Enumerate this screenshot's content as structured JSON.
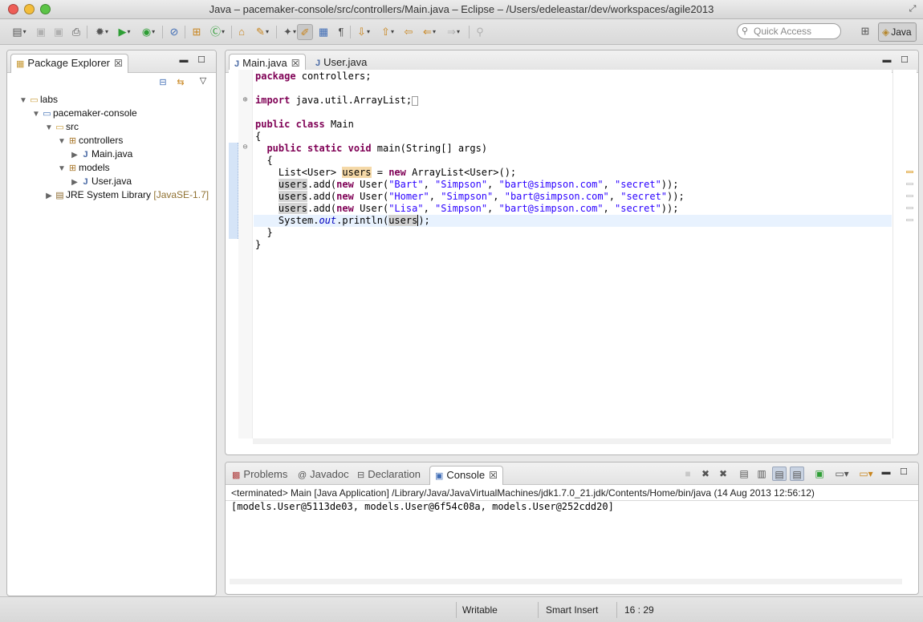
{
  "window": {
    "title": "Java – pacemaker-console/src/controllers/Main.java – Eclipse – /Users/edeleastar/dev/workspaces/agile2013"
  },
  "toolbar": {
    "quick_access_placeholder": "Quick Access",
    "perspective_label": "Java"
  },
  "package_explorer": {
    "title": "Package Explorer",
    "tree": [
      {
        "label": "labs",
        "depth": 0,
        "expanded": true,
        "icon": "folder-icon"
      },
      {
        "label": "pacemaker-console",
        "depth": 1,
        "expanded": true,
        "icon": "project-icon"
      },
      {
        "label": "src",
        "depth": 2,
        "expanded": true,
        "icon": "source-folder-icon"
      },
      {
        "label": "controllers",
        "depth": 3,
        "expanded": true,
        "icon": "package-icon"
      },
      {
        "label": "Main.java",
        "depth": 4,
        "expanded": false,
        "icon": "java-file-icon"
      },
      {
        "label": "models",
        "depth": 3,
        "expanded": true,
        "icon": "package-icon"
      },
      {
        "label": "User.java",
        "depth": 4,
        "expanded": false,
        "icon": "java-file-icon"
      },
      {
        "label": "JRE System Library",
        "decoration": "[JavaSE-1.7]",
        "depth": 1,
        "expanded": false,
        "icon": "library-icon"
      }
    ]
  },
  "editor": {
    "tabs": [
      {
        "label": "Main.java",
        "active": true
      },
      {
        "label": "User.java",
        "active": false
      }
    ],
    "code": {
      "pkg_kw": "package",
      "pkg_rest": " controllers;",
      "imp_kw": "import",
      "imp_rest": " java.util.ArrayList;",
      "imp_collapsed": "",
      "l_public1": "public",
      "l_class": "class",
      "l_main_name": " Main",
      "brace_open": "{",
      "l_public2": "public",
      "l_static": "static",
      "l_void": "void",
      "l_main_sig": " main(String[] args)",
      "brace_open_inner": "  {",
      "list_decl_a": "    List<User> ",
      "users": "users",
      "list_eq": " = ",
      "l_new": "new",
      "list_decl_b": " ArrayList<User>();",
      "add_a": ".add(",
      "user_ctor": " User(",
      "comma": ", ",
      "ctor_end": "));",
      "s_bart": "\"Bart\"",
      "s_homer": "\"Homer\"",
      "s_lisa": "\"Lisa\"",
      "s_simpson": "\"Simpson\"",
      "s_email": "\"bart@simpson.com\"",
      "s_secret": "\"secret\"",
      "sys_a": "    System.",
      "sys_out": "out",
      "sys_b": ".println(",
      "sys_end": ");",
      "brace_close_inner": "  }",
      "brace_close": "}"
    }
  },
  "bottom_panel": {
    "tabs": [
      {
        "label": "Problems",
        "active": false
      },
      {
        "label": "Javadoc",
        "active": false
      },
      {
        "label": "Declaration",
        "active": false
      },
      {
        "label": "Console",
        "active": true
      }
    ],
    "console_header": "<terminated> Main [Java Application] /Library/Java/JavaVirtualMachines/jdk1.7.0_21.jdk/Contents/Home/bin/java (14 Aug 2013 12:56:12)",
    "console_output": "[models.User@5113de03, models.User@6f54c08a, models.User@252cdd20]"
  },
  "status": {
    "writable": "Writable",
    "insert_mode": "Smart Insert",
    "position": "16 : 29"
  }
}
